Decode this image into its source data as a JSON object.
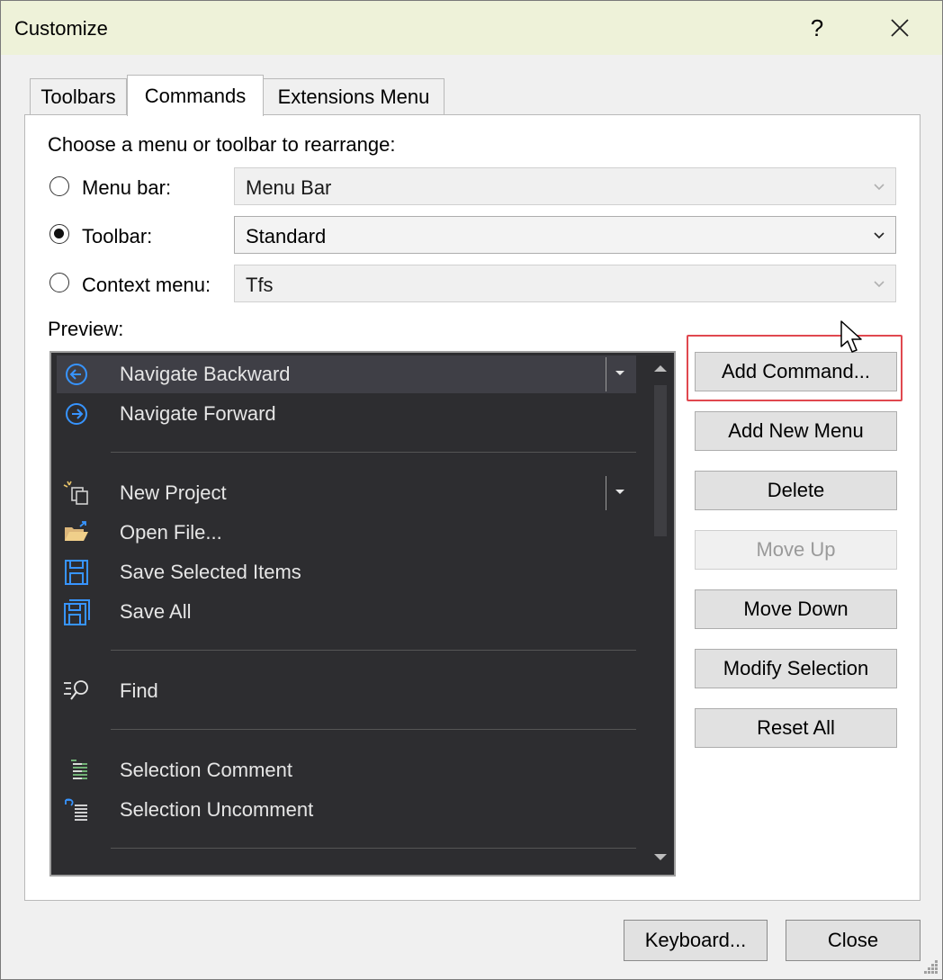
{
  "window": {
    "title": "Customize",
    "help_label": "?"
  },
  "tabs": [
    {
      "label": "Toolbars"
    },
    {
      "label": "Commands"
    },
    {
      "label": "Extensions Menu"
    }
  ],
  "chooser": {
    "heading": "Choose a menu or toolbar to rearrange:",
    "menu_bar": {
      "label": "Menu bar:",
      "value": "Menu Bar"
    },
    "toolbar": {
      "label": "Toolbar:",
      "value": "Standard"
    },
    "context_menu": {
      "label": "Context menu:",
      "value": "Tfs"
    }
  },
  "preview": {
    "label": "Preview:",
    "items": [
      {
        "label": "Navigate Backward",
        "icon": "navigate-back-icon"
      },
      {
        "label": "Navigate Forward",
        "icon": "navigate-forward-icon"
      },
      {
        "label": "New Project",
        "icon": "new-project-icon"
      },
      {
        "label": "Open File...",
        "icon": "open-folder-icon"
      },
      {
        "label": "Save Selected Items",
        "icon": "save-icon"
      },
      {
        "label": "Save All",
        "icon": "save-all-icon"
      },
      {
        "label": "Find",
        "icon": "find-icon"
      },
      {
        "label": "Selection Comment",
        "icon": "comment-icon"
      },
      {
        "label": "Selection Uncomment",
        "icon": "uncomment-icon"
      }
    ]
  },
  "actions": {
    "add_command": "Add Command...",
    "add_new_menu": "Add New Menu",
    "delete": "Delete",
    "move_up": "Move Up",
    "move_down": "Move Down",
    "modify_selection": "Modify Selection",
    "reset_all": "Reset All"
  },
  "footer": {
    "keyboard": "Keyboard...",
    "close": "Close"
  },
  "colors": {
    "titlebar": "#eef2d9",
    "preview_bg": "#2d2d30",
    "icon_blue": "#3794ff",
    "highlight": "#e0484f"
  }
}
